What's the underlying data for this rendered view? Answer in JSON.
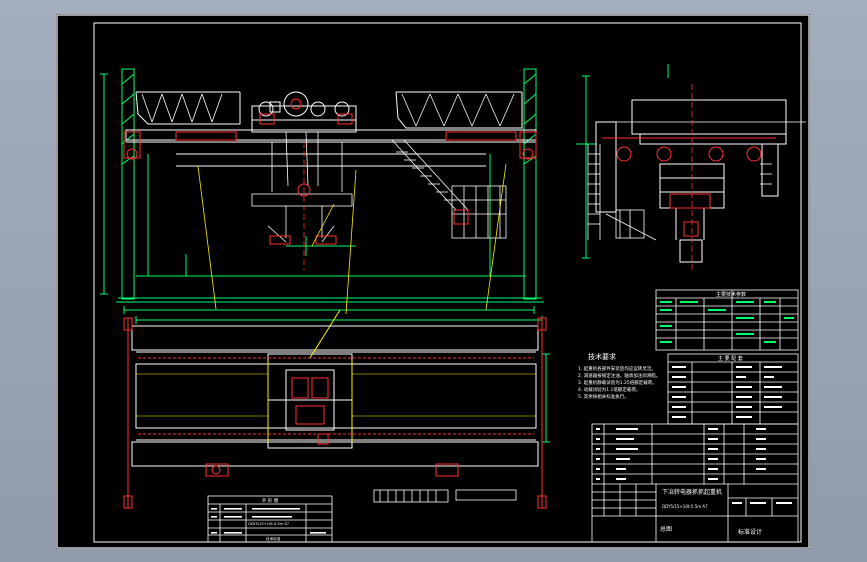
{
  "drawing": {
    "title": "下冶转电器抓抓起重机",
    "subtitle": "QDY5/15+10t-5.5m A7",
    "drawing_name": "总图",
    "tech_req_title": "技术要求",
    "tech_req_lines": [
      "1. 起重机各部件安装后均应运转灵活。",
      "2. 减速器按规定注油，轴承加注润滑脂。",
      "3. 起重机静载试验为1.25倍额定载荷。",
      "4. 动载试验为1.1倍额定载荷。",
      "5. 其余按相关标准执行。"
    ],
    "params_title": "主要技术参数",
    "spec_title": "主 要 配 套",
    "design_title": "标准设计",
    "left_table_title": "外 形 图",
    "left_table_note": "QDY5/15+10t-5.5m A7",
    "left_table_footer": "技术标准"
  }
}
